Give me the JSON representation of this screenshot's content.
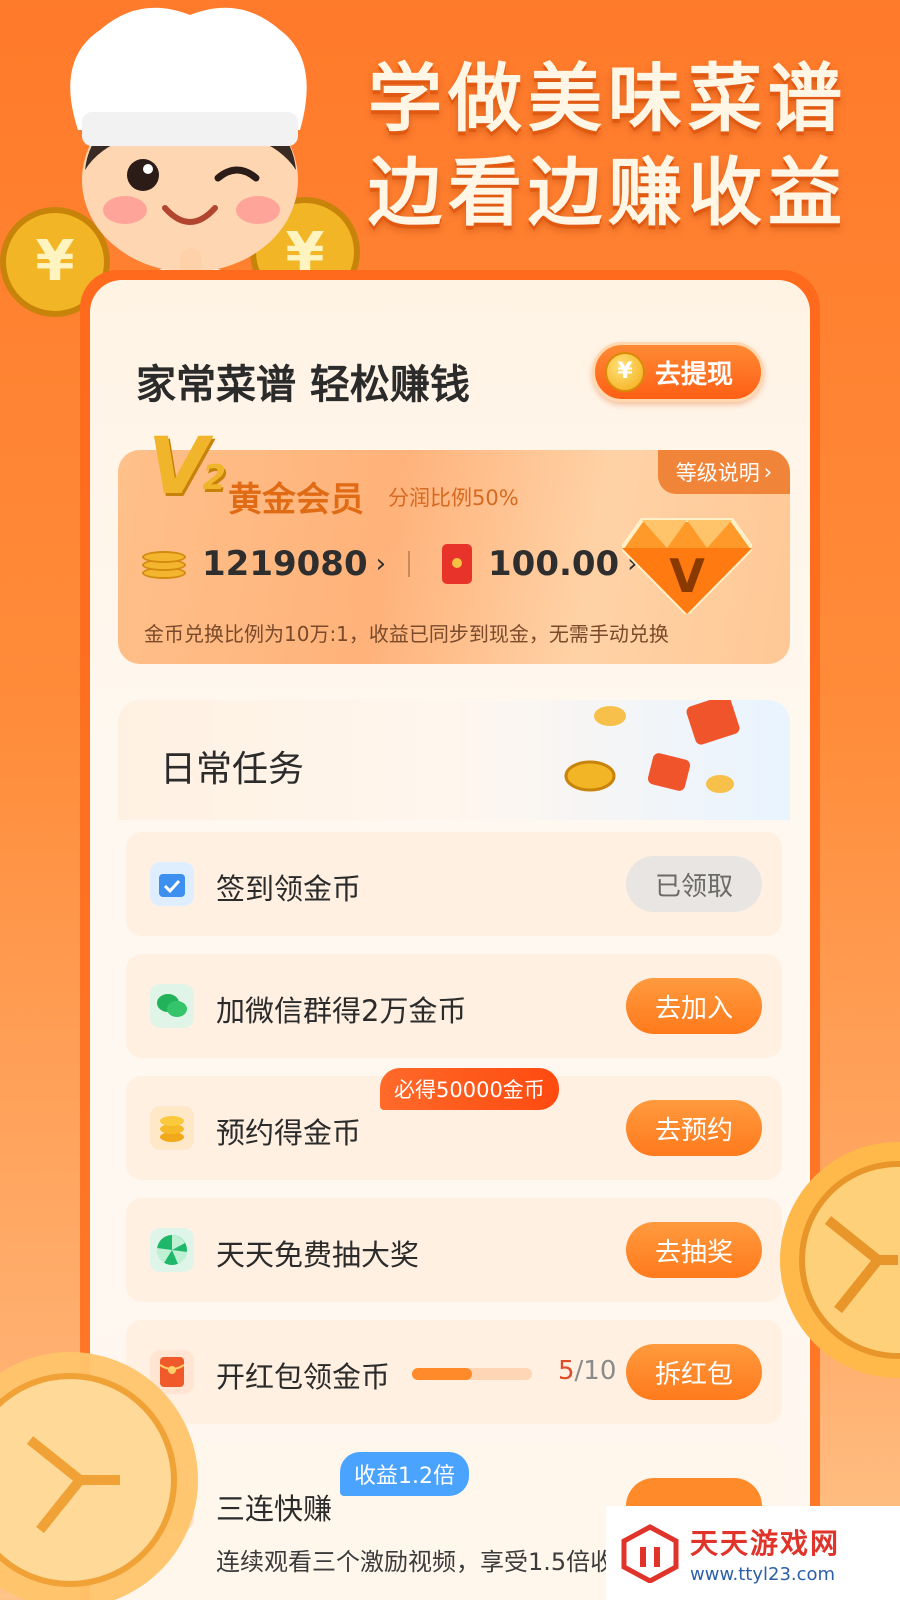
{
  "hero": {
    "line1": "学做美味菜谱",
    "line2": "边看边赚收益"
  },
  "header": {
    "title": "家常菜谱 轻松赚钱",
    "withdraw_label": "去提现",
    "withdraw_icon": "yen-coin-icon"
  },
  "member": {
    "level_mark": "V",
    "level_num": "2",
    "title": "黄金会员",
    "share_ratio": "分润比例50%",
    "level_link": "等级说明",
    "coins": "1219080",
    "cash": "100.00",
    "note": "金币兑换比例为10万:1，收益已同步到现金，无需手动兑换"
  },
  "tasks": {
    "title": "日常任务",
    "items": [
      {
        "label": "签到领金币",
        "button": "已领取",
        "icon": "calendar-check-icon"
      },
      {
        "label": "加微信群得2万金币",
        "button": "去加入",
        "icon": "wechat-icon"
      },
      {
        "label": "预约得金币",
        "button": "去预约",
        "badge": "必得50000金币",
        "icon": "coin-stack-icon"
      },
      {
        "label": "天天免费抽大奖",
        "button": "去抽奖",
        "icon": "lottery-wheel-icon"
      },
      {
        "label": "开红包领金币",
        "button": "拆红包",
        "progress_current": "5",
        "progress_total": "/10",
        "progress_fraction": 0.5,
        "icon": "red-envelope-icon"
      },
      {
        "label": "三连快赚",
        "badge": "收益1.2倍",
        "desc": "连续观看三个激励视频，享受1.5倍收"
      }
    ]
  },
  "watermark": {
    "name": "天天游戏网",
    "url": "www.ttyl23.com"
  },
  "colors": {
    "accent": "#ff7a1c",
    "background": "#ff7a2a",
    "badge_blue": "#4aa3ff"
  }
}
